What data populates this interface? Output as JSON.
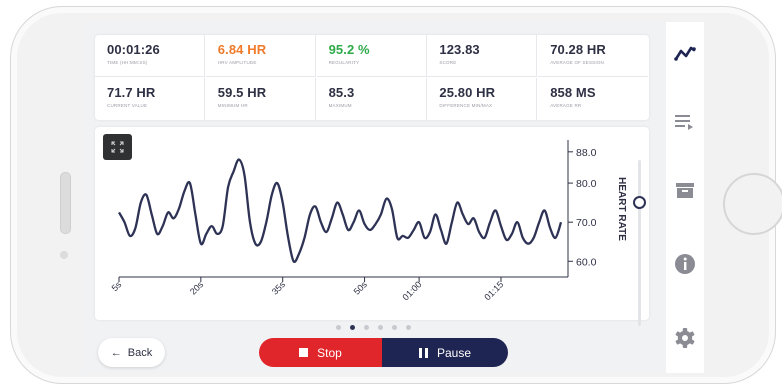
{
  "stats": [
    {
      "value": "00:01:26",
      "label": "TIME (HH:MM:SS)",
      "color": "#2e3044"
    },
    {
      "value": "6.84 HR",
      "label": "HRV AMPLITUDE",
      "color": "#f07b2a"
    },
    {
      "value": "95.2 %",
      "label": "REGULARITY",
      "color": "#2eaa4a"
    },
    {
      "value": "123.83",
      "label": "SCORE",
      "color": "#2e3044"
    },
    {
      "value": "70.28 HR",
      "label": "AVERAGE OF SESSION",
      "color": "#2e3044"
    },
    {
      "value": "71.7 HR",
      "label": "CURRENT VALUE",
      "color": "#2e3044"
    },
    {
      "value": "59.5 HR",
      "label": "MINIMUM HR",
      "color": "#2e3044"
    },
    {
      "value": "85.3",
      "label": "MAXIMUM",
      "color": "#2e3044"
    },
    {
      "value": "25.80 HR",
      "label": "DIFFERENCE MIN/MAX",
      "color": "#2e3044"
    },
    {
      "value": "858 MS",
      "label": "AVERAGE RR",
      "color": "#2e3044"
    }
  ],
  "chart_data": {
    "type": "line",
    "ylabel": "HEART RATE",
    "ylim": [
      57,
      90
    ],
    "y_ticks": [
      "88.0",
      "80.0",
      "70.0",
      "60.0"
    ],
    "y_tick_values": [
      88,
      80,
      70,
      60
    ],
    "x_ticks": [
      "5s",
      "20s",
      "35s",
      "50s",
      "01:00",
      "01:15"
    ],
    "x_tick_values": [
      5,
      20,
      35,
      50,
      60,
      75
    ],
    "xlim": [
      5,
      86
    ],
    "series": [
      {
        "values": [
          [
            5,
            72.5
          ],
          [
            6,
            70
          ],
          [
            7,
            66.5
          ],
          [
            8,
            68.5
          ],
          [
            9,
            75
          ],
          [
            10,
            77
          ],
          [
            11,
            72
          ],
          [
            12,
            67
          ],
          [
            13,
            69
          ],
          [
            14,
            72.5
          ],
          [
            15,
            71
          ],
          [
            16,
            73.5
          ],
          [
            17,
            78
          ],
          [
            18,
            80
          ],
          [
            19,
            72
          ],
          [
            20,
            64.5
          ],
          [
            21,
            67
          ],
          [
            22,
            69
          ],
          [
            23,
            67
          ],
          [
            24,
            69
          ],
          [
            25,
            79
          ],
          [
            26,
            83
          ],
          [
            27,
            86
          ],
          [
            28,
            82
          ],
          [
            29,
            70
          ],
          [
            30,
            64.5
          ],
          [
            31,
            65
          ],
          [
            32,
            70
          ],
          [
            33,
            77
          ],
          [
            34,
            80
          ],
          [
            35,
            75
          ],
          [
            36,
            66
          ],
          [
            37,
            60
          ],
          [
            38,
            62
          ],
          [
            39,
            66
          ],
          [
            40,
            72
          ],
          [
            41,
            74
          ],
          [
            42,
            70
          ],
          [
            43,
            67.5
          ],
          [
            44,
            71
          ],
          [
            45,
            75
          ],
          [
            46,
            72
          ],
          [
            47,
            68
          ],
          [
            48,
            70
          ],
          [
            49,
            73
          ],
          [
            50,
            69.5
          ],
          [
            51,
            68
          ],
          [
            52,
            69.5
          ],
          [
            53,
            72
          ],
          [
            54,
            76
          ],
          [
            55,
            73.5
          ],
          [
            56,
            66
          ],
          [
            57,
            66.5
          ],
          [
            58,
            66
          ],
          [
            59,
            68
          ],
          [
            60,
            70
          ],
          [
            61,
            66
          ],
          [
            62,
            67.5
          ],
          [
            63,
            72
          ],
          [
            64,
            68
          ],
          [
            65,
            64.5
          ],
          [
            66,
            70
          ],
          [
            67,
            75
          ],
          [
            68,
            72
          ],
          [
            69,
            69.5
          ],
          [
            70,
            71
          ],
          [
            71,
            67.5
          ],
          [
            72,
            66
          ],
          [
            73,
            70
          ],
          [
            74,
            73
          ],
          [
            75,
            69
          ],
          [
            76,
            65.5
          ],
          [
            77,
            67
          ],
          [
            78,
            70
          ],
          [
            79,
            66
          ],
          [
            80,
            64.5
          ],
          [
            81,
            66
          ],
          [
            82,
            70
          ],
          [
            83,
            73
          ],
          [
            84,
            68.5
          ],
          [
            85,
            66
          ],
          [
            86,
            70
          ]
        ]
      }
    ],
    "line_color": "#2e3355",
    "grid": false
  },
  "pagination": {
    "total": 6,
    "active": 1
  },
  "controls": {
    "back_label": "Back",
    "stop_label": "Stop",
    "pause_label": "Pause",
    "stop_color": "#e0262b",
    "pause_color": "#1f2552"
  },
  "sidebar": {
    "icons": [
      "chart-line-icon",
      "playlist-icon",
      "archive-icon",
      "info-icon",
      "gear-icon"
    ]
  }
}
